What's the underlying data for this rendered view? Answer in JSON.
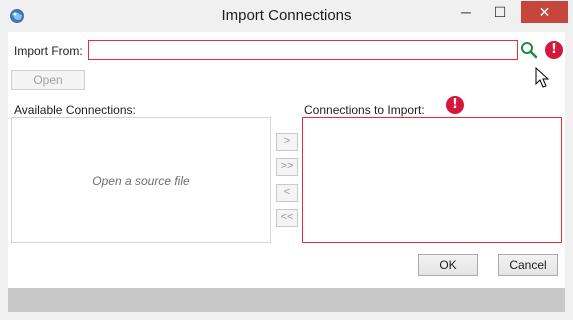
{
  "window": {
    "title": "Import Connections",
    "app_icon": "globe-app-icon",
    "controls": {
      "minimize": "─",
      "maximize": "☐",
      "close": "✕"
    }
  },
  "import_from": {
    "label": "Import From:",
    "value": "",
    "search_icon": "search-icon",
    "error_icon_glyph": "!"
  },
  "open_button": {
    "label": "Open"
  },
  "available": {
    "label": "Available Connections:",
    "placeholder": "Open a source file"
  },
  "transfer_buttons": [
    {
      "label": ">"
    },
    {
      "label": ">>"
    },
    {
      "label": "<"
    },
    {
      "label": "<<"
    }
  ],
  "to_import": {
    "label": "Connections to Import:",
    "error_icon_glyph": "!"
  },
  "buttons": {
    "ok": "OK",
    "cancel": "Cancel"
  },
  "colors": {
    "error": "#e0313a",
    "error_badge": "#d4173a",
    "close_button": "#c7463b",
    "footer": "#c8c8c8"
  }
}
